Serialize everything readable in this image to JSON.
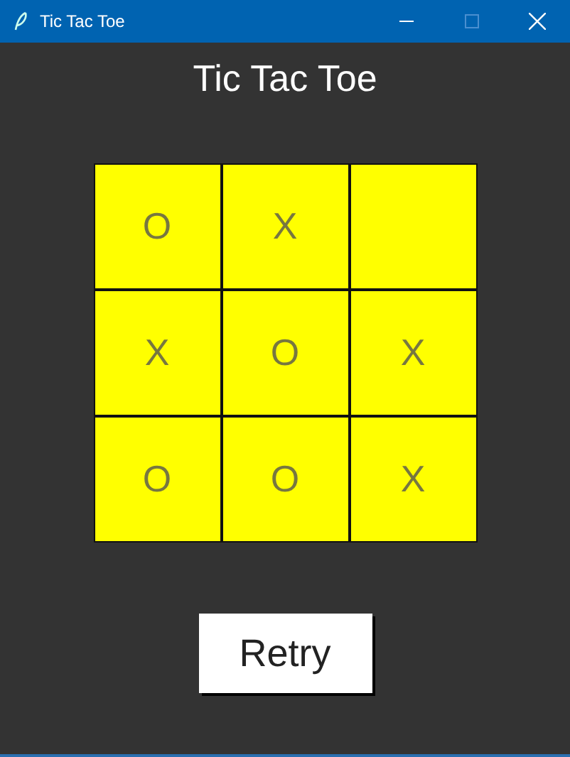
{
  "window": {
    "title": "Tic Tac Toe"
  },
  "heading": "Tic Tac Toe",
  "board": [
    {
      "kind": "mark",
      "mark": "O"
    },
    {
      "kind": "mark",
      "mark": "X"
    },
    {
      "kind": "empty"
    },
    {
      "kind": "mark",
      "mark": "X"
    },
    {
      "kind": "mark",
      "mark": "O"
    },
    {
      "kind": "mark",
      "mark": "X"
    },
    {
      "kind": "mark",
      "mark": "O"
    },
    {
      "kind": "mark",
      "mark": "O"
    },
    {
      "kind": "mark",
      "mark": "X"
    }
  ],
  "button": "Retry"
}
